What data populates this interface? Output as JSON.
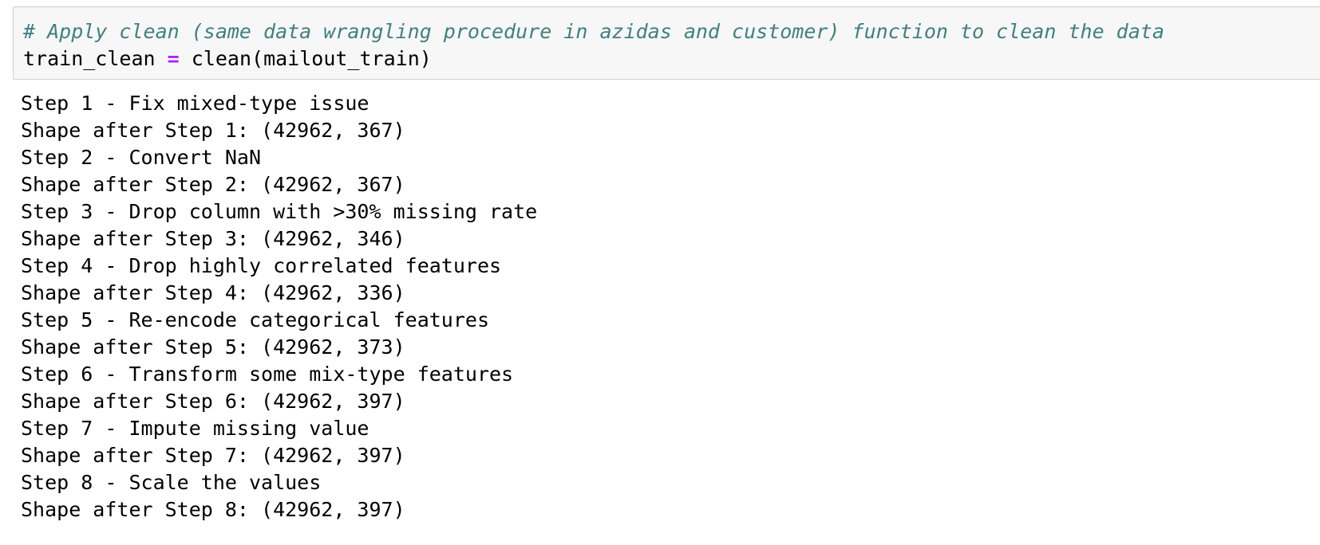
{
  "code": {
    "comment": "# Apply clean (same data wrangling procedure in azidas and customer) function to clean the data",
    "var": "train_clean",
    "op": "=",
    "call": "clean(mailout_train)"
  },
  "output": {
    "lines": [
      "Step 1 - Fix mixed-type issue",
      "Shape after Step 1: (42962, 367)",
      "Step 2 - Convert NaN",
      "Shape after Step 2: (42962, 367)",
      "Step 3 - Drop column with >30% missing rate",
      "Shape after Step 3: (42962, 346)",
      "Step 4 - Drop highly correlated features",
      "Shape after Step 4: (42962, 336)",
      "Step 5 - Re-encode categorical features",
      "Shape after Step 5: (42962, 373)",
      "Step 6 - Transform some mix-type features",
      "Shape after Step 6: (42962, 397)",
      "Step 7 - Impute missing value",
      "Shape after Step 7: (42962, 397)",
      "Step 8 - Scale the values",
      "Shape after Step 8: (42962, 397)"
    ]
  }
}
